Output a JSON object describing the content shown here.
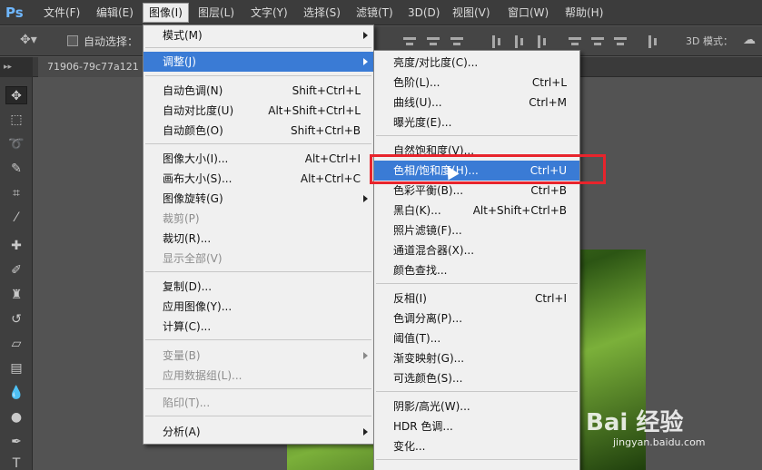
{
  "app_logo": "Ps",
  "menubar": {
    "items": [
      "文件(F)",
      "编辑(E)",
      "图像(I)",
      "图层(L)",
      "文字(Y)",
      "选择(S)",
      "滤镜(T)",
      "3D(D)",
      "视图(V)",
      "窗口(W)",
      "帮助(H)"
    ]
  },
  "options_bar": {
    "auto_select_label": "自动选择：",
    "mode_3d_label": "3D 模式："
  },
  "document_tab": "71906-79c77a121",
  "image_menu": {
    "items": [
      {
        "label": "模式(M)",
        "shortcut": "",
        "submenu": true,
        "disabled": false
      },
      {
        "label": "调整(J)",
        "shortcut": "",
        "submenu": true,
        "disabled": false,
        "highlighted": true
      },
      {
        "label": "自动色调(N)",
        "shortcut": "Shift+Ctrl+L",
        "submenu": false,
        "disabled": false
      },
      {
        "label": "自动对比度(U)",
        "shortcut": "Alt+Shift+Ctrl+L",
        "submenu": false,
        "disabled": false
      },
      {
        "label": "自动颜色(O)",
        "shortcut": "Shift+Ctrl+B",
        "submenu": false,
        "disabled": false
      },
      {
        "label": "图像大小(I)...",
        "shortcut": "Alt+Ctrl+I",
        "submenu": false,
        "disabled": false
      },
      {
        "label": "画布大小(S)...",
        "shortcut": "Alt+Ctrl+C",
        "submenu": false,
        "disabled": false
      },
      {
        "label": "图像旋转(G)",
        "shortcut": "",
        "submenu": true,
        "disabled": false
      },
      {
        "label": "裁剪(P)",
        "shortcut": "",
        "submenu": false,
        "disabled": true
      },
      {
        "label": "裁切(R)...",
        "shortcut": "",
        "submenu": false,
        "disabled": false
      },
      {
        "label": "显示全部(V)",
        "shortcut": "",
        "submenu": false,
        "disabled": true
      },
      {
        "label": "复制(D)...",
        "shortcut": "",
        "submenu": false,
        "disabled": false
      },
      {
        "label": "应用图像(Y)...",
        "shortcut": "",
        "submenu": false,
        "disabled": false
      },
      {
        "label": "计算(C)...",
        "shortcut": "",
        "submenu": false,
        "disabled": false
      },
      {
        "label": "变量(B)",
        "shortcut": "",
        "submenu": true,
        "disabled": true
      },
      {
        "label": "应用数据组(L)...",
        "shortcut": "",
        "submenu": false,
        "disabled": true
      },
      {
        "label": "陷印(T)...",
        "shortcut": "",
        "submenu": false,
        "disabled": true
      },
      {
        "label": "分析(A)",
        "shortcut": "",
        "submenu": true,
        "disabled": false
      }
    ]
  },
  "adjust_menu": {
    "items": [
      {
        "label": "亮度/对比度(C)...",
        "shortcut": ""
      },
      {
        "label": "色阶(L)...",
        "shortcut": "Ctrl+L"
      },
      {
        "label": "曲线(U)...",
        "shortcut": "Ctrl+M"
      },
      {
        "label": "曝光度(E)...",
        "shortcut": ""
      },
      {
        "label": "自然饱和度(V)...",
        "shortcut": ""
      },
      {
        "label": "色相/饱和度(H)...",
        "shortcut": "Ctrl+U",
        "highlighted": true
      },
      {
        "label": "色彩平衡(B)...",
        "shortcut": "Ctrl+B"
      },
      {
        "label": "黑白(K)...",
        "shortcut": "Alt+Shift+Ctrl+B"
      },
      {
        "label": "照片滤镜(F)...",
        "shortcut": ""
      },
      {
        "label": "通道混合器(X)...",
        "shortcut": ""
      },
      {
        "label": "颜色查找...",
        "shortcut": ""
      },
      {
        "label": "反相(I)",
        "shortcut": "Ctrl+I"
      },
      {
        "label": "色调分离(P)...",
        "shortcut": ""
      },
      {
        "label": "阈值(T)...",
        "shortcut": ""
      },
      {
        "label": "渐变映射(G)...",
        "shortcut": ""
      },
      {
        "label": "可选颜色(S)...",
        "shortcut": ""
      },
      {
        "label": "阴影/高光(W)...",
        "shortcut": ""
      },
      {
        "label": "HDR 色调...",
        "shortcut": ""
      },
      {
        "label": "变化...",
        "shortcut": ""
      }
    ]
  },
  "watermark": {
    "text": "Bai 经验",
    "url": "jingyan.baidu.com"
  },
  "colors": {
    "highlight": "#3a7bd5",
    "annotation_box": "#e8242c"
  }
}
